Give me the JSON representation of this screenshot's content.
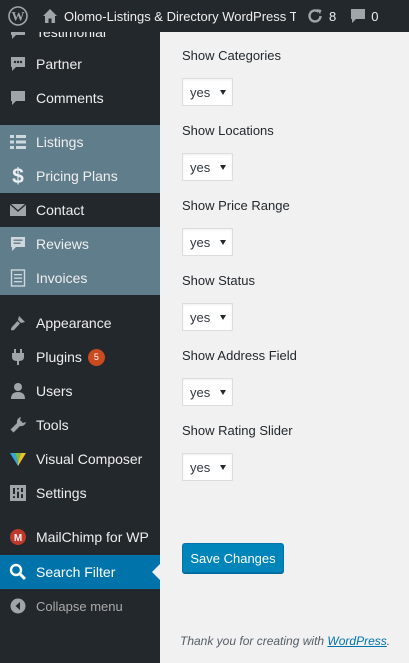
{
  "adminbar": {
    "site_name": "Olomo-Listings & Directory WordPress Theme",
    "updates_count": "8",
    "comments_count": "0"
  },
  "sidebar": {
    "items": [
      {
        "label": "Testimonial",
        "icon": "testimonial-icon"
      },
      {
        "label": "Partner",
        "icon": "partner-icon"
      },
      {
        "label": "Comments",
        "icon": "comments-icon"
      },
      {
        "label": "Listings",
        "icon": "listings-icon"
      },
      {
        "label": "Pricing Plans",
        "icon": "dollar-icon"
      },
      {
        "label": "Contact",
        "icon": "envelope-icon"
      },
      {
        "label": "Reviews",
        "icon": "reviews-icon"
      },
      {
        "label": "Invoices",
        "icon": "invoices-icon"
      },
      {
        "label": "Appearance",
        "icon": "paintbrush-icon"
      },
      {
        "label": "Plugins",
        "icon": "plugin-icon",
        "badge": "5"
      },
      {
        "label": "Users",
        "icon": "users-icon"
      },
      {
        "label": "Tools",
        "icon": "wrench-icon"
      },
      {
        "label": "Visual Composer",
        "icon": "visual-composer-icon"
      },
      {
        "label": "Settings",
        "icon": "settings-icon"
      },
      {
        "label": "MailChimp for WP",
        "icon": "mailchimp-icon"
      },
      {
        "label": "Search Filter",
        "icon": "search-icon"
      }
    ],
    "collapse_label": "Collapse menu",
    "colors": {
      "background": "#23282d",
      "highlight": "#607d8b",
      "current": "#0073aa"
    }
  },
  "settings": {
    "fields": [
      {
        "label": "Show Categories",
        "value": "yes"
      },
      {
        "label": "Show Locations",
        "value": "yes"
      },
      {
        "label": "Show Price Range",
        "value": "yes"
      },
      {
        "label": "Show Status",
        "value": "yes"
      },
      {
        "label": "Show Address Field",
        "value": "yes"
      },
      {
        "label": "Show Rating Slider",
        "value": "yes"
      }
    ],
    "save_label": "Save Changes"
  },
  "footer": {
    "text": "Thank you for creating with ",
    "link": "WordPress",
    "suffix": "."
  }
}
